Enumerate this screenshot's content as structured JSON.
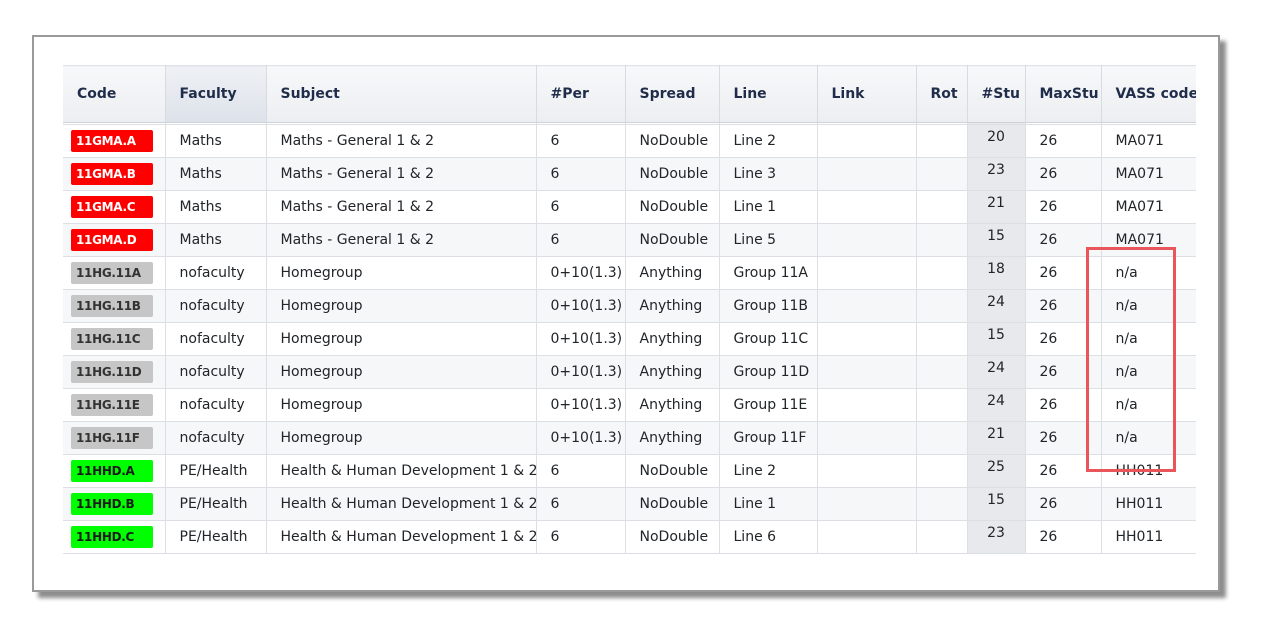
{
  "columns": [
    "Code",
    "Faculty",
    "Subject",
    "#Per",
    "Spread",
    "Line",
    "Link",
    "Rot",
    "#Stu",
    "MaxStu",
    "VASS code"
  ],
  "sorted_column": "Faculty",
  "rows": [
    {
      "code": "11GMA.A",
      "code_color": "red",
      "faculty": "Maths",
      "subject": "Maths - General 1 & 2",
      "per": "6",
      "spread": "NoDouble",
      "line": "Line 2",
      "link": "",
      "rot": "",
      "stu": "20",
      "maxstu": "26",
      "vass": "MA071"
    },
    {
      "code": "11GMA.B",
      "code_color": "red",
      "faculty": "Maths",
      "subject": "Maths - General 1 & 2",
      "per": "6",
      "spread": "NoDouble",
      "line": "Line 3",
      "link": "",
      "rot": "",
      "stu": "23",
      "maxstu": "26",
      "vass": "MA071"
    },
    {
      "code": "11GMA.C",
      "code_color": "red",
      "faculty": "Maths",
      "subject": "Maths - General 1 & 2",
      "per": "6",
      "spread": "NoDouble",
      "line": "Line 1",
      "link": "",
      "rot": "",
      "stu": "21",
      "maxstu": "26",
      "vass": "MA071"
    },
    {
      "code": "11GMA.D",
      "code_color": "red",
      "faculty": "Maths",
      "subject": "Maths - General 1 & 2",
      "per": "6",
      "spread": "NoDouble",
      "line": "Line 5",
      "link": "",
      "rot": "",
      "stu": "15",
      "maxstu": "26",
      "vass": "MA071"
    },
    {
      "code": "11HG.11A",
      "code_color": "grey",
      "faculty": "nofaculty",
      "subject": "Homegroup",
      "per": "0+10(1.3)",
      "spread": "Anything",
      "line": "Group 11A",
      "link": "",
      "rot": "",
      "stu": "18",
      "maxstu": "26",
      "vass": "n/a"
    },
    {
      "code": "11HG.11B",
      "code_color": "grey",
      "faculty": "nofaculty",
      "subject": "Homegroup",
      "per": "0+10(1.3)",
      "spread": "Anything",
      "line": "Group 11B",
      "link": "",
      "rot": "",
      "stu": "24",
      "maxstu": "26",
      "vass": "n/a"
    },
    {
      "code": "11HG.11C",
      "code_color": "grey",
      "faculty": "nofaculty",
      "subject": "Homegroup",
      "per": "0+10(1.3)",
      "spread": "Anything",
      "line": "Group 11C",
      "link": "",
      "rot": "",
      "stu": "15",
      "maxstu": "26",
      "vass": "n/a"
    },
    {
      "code": "11HG.11D",
      "code_color": "grey",
      "faculty": "nofaculty",
      "subject": "Homegroup",
      "per": "0+10(1.3)",
      "spread": "Anything",
      "line": "Group 11D",
      "link": "",
      "rot": "",
      "stu": "24",
      "maxstu": "26",
      "vass": "n/a"
    },
    {
      "code": "11HG.11E",
      "code_color": "grey",
      "faculty": "nofaculty",
      "subject": "Homegroup",
      "per": "0+10(1.3)",
      "spread": "Anything",
      "line": "Group 11E",
      "link": "",
      "rot": "",
      "stu": "24",
      "maxstu": "26",
      "vass": "n/a"
    },
    {
      "code": "11HG.11F",
      "code_color": "grey",
      "faculty": "nofaculty",
      "subject": "Homegroup",
      "per": "0+10(1.3)",
      "spread": "Anything",
      "line": "Group 11F",
      "link": "",
      "rot": "",
      "stu": "21",
      "maxstu": "26",
      "vass": "n/a"
    },
    {
      "code": "11HHD.A",
      "code_color": "green",
      "faculty": "PE/Health",
      "subject": "Health & Human Development 1 & 2",
      "per": "6",
      "spread": "NoDouble",
      "line": "Line 2",
      "link": "",
      "rot": "",
      "stu": "25",
      "maxstu": "26",
      "vass": "HH011"
    },
    {
      "code": "11HHD.B",
      "code_color": "green",
      "faculty": "PE/Health",
      "subject": "Health & Human Development 1 & 2",
      "per": "6",
      "spread": "NoDouble",
      "line": "Line 1",
      "link": "",
      "rot": "",
      "stu": "15",
      "maxstu": "26",
      "vass": "HH011"
    },
    {
      "code": "11HHD.C",
      "code_color": "green",
      "faculty": "PE/Health",
      "subject": "Health & Human Development 1 & 2",
      "per": "6",
      "spread": "NoDouble",
      "line": "Line 6",
      "link": "",
      "rot": "",
      "stu": "23",
      "maxstu": "26",
      "vass": "HH011"
    }
  ],
  "colors": {
    "red": "#ff0000",
    "grey": "#c6c6c6",
    "green": "#00ff00",
    "highlight": "#e8555b"
  }
}
